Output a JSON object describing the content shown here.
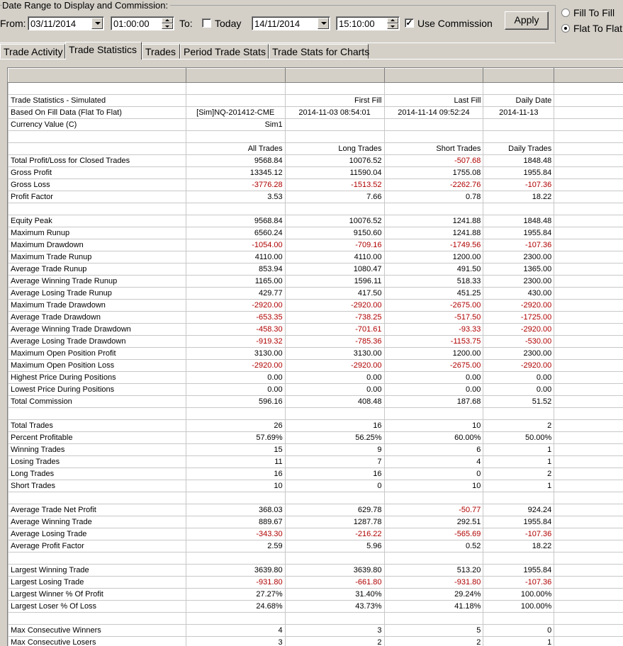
{
  "filter": {
    "group_title": "Date Range to Display and Commission:",
    "from_label": "From:",
    "from_date": "03/11/2014",
    "from_time": "01:00:00",
    "to_label": "To:",
    "today_label": "Today",
    "today_checked": false,
    "to_date": "14/11/2014",
    "to_time": "15:10:00",
    "use_commission_label": "Use Commission",
    "use_commission_checked": true,
    "apply_label": "Apply",
    "fill_to_fill_label": "Fill To Fill",
    "flat_to_flat_label": "Flat To Flat",
    "selected_mode": "Flat To Flat"
  },
  "tabs": [
    {
      "label": "Trade Activity",
      "active": false
    },
    {
      "label": "Trade Statistics",
      "active": true
    },
    {
      "label": "Trades",
      "active": false
    },
    {
      "label": "Period Trade Stats",
      "active": false
    },
    {
      "label": "Trade Stats for Charts",
      "active": false
    }
  ],
  "colors": {
    "negative": "#b00000",
    "window_bg": "#d4d0c8"
  },
  "rows": [
    {
      "label": "",
      "cells": [
        "",
        "",
        "",
        ""
      ],
      "neg": []
    },
    {
      "label": "Trade Statistics - Simulated",
      "cells": [
        "",
        "First Fill",
        "Last Fill",
        "Daily Date"
      ],
      "neg": []
    },
    {
      "label": "Based On Fill Data (Flat To Flat)",
      "cells": [
        "[Sim]NQ-201412-CME",
        "2014-11-03  08:54:01",
        "2014-11-14  09:52:24",
        "2014-11-13"
      ],
      "neg": [],
      "center": [
        0,
        1,
        2,
        3
      ]
    },
    {
      "label": "Currency Value (C)",
      "cells": [
        "Sim1",
        "",
        "",
        ""
      ],
      "neg": []
    },
    {
      "label": "",
      "cells": [
        "",
        "",
        "",
        ""
      ],
      "neg": []
    },
    {
      "label": "",
      "cells": [
        "All Trades",
        "Long Trades",
        "Short Trades",
        "Daily Trades"
      ],
      "neg": []
    },
    {
      "label": "Total Profit/Loss for Closed Trades",
      "cells": [
        "9568.84",
        "10076.52",
        "-507.68",
        "1848.48"
      ],
      "neg": [
        2
      ]
    },
    {
      "label": "Gross Profit",
      "cells": [
        "13345.12",
        "11590.04",
        "1755.08",
        "1955.84"
      ],
      "neg": []
    },
    {
      "label": "Gross Loss",
      "cells": [
        "-3776.28",
        "-1513.52",
        "-2262.76",
        "-107.36"
      ],
      "neg": [
        0,
        1,
        2,
        3
      ]
    },
    {
      "label": "Profit Factor",
      "cells": [
        "3.53",
        "7.66",
        "0.78",
        "18.22"
      ],
      "neg": []
    },
    {
      "label": "",
      "cells": [
        "",
        "",
        "",
        ""
      ],
      "neg": []
    },
    {
      "label": "Equity Peak",
      "cells": [
        "9568.84",
        "10076.52",
        "1241.88",
        "1848.48"
      ],
      "neg": []
    },
    {
      "label": "Maximum Runup",
      "cells": [
        "6560.24",
        "9150.60",
        "1241.88",
        "1955.84"
      ],
      "neg": []
    },
    {
      "label": "Maximum Drawdown",
      "cells": [
        "-1054.00",
        "-709.16",
        "-1749.56",
        "-107.36"
      ],
      "neg": [
        0,
        1,
        2,
        3
      ]
    },
    {
      "label": "Maximum Trade Runup",
      "cells": [
        "4110.00",
        "4110.00",
        "1200.00",
        "2300.00"
      ],
      "neg": []
    },
    {
      "label": "Average Trade Runup",
      "cells": [
        "853.94",
        "1080.47",
        "491.50",
        "1365.00"
      ],
      "neg": []
    },
    {
      "label": "Average Winning Trade Runup",
      "cells": [
        "1165.00",
        "1596.11",
        "518.33",
        "2300.00"
      ],
      "neg": []
    },
    {
      "label": "Average Losing Trade Runup",
      "cells": [
        "429.77",
        "417.50",
        "451.25",
        "430.00"
      ],
      "neg": []
    },
    {
      "label": "Maximum Trade Drawdown",
      "cells": [
        "-2920.00",
        "-2920.00",
        "-2675.00",
        "-2920.00"
      ],
      "neg": [
        0,
        1,
        2,
        3
      ]
    },
    {
      "label": "Average Trade Drawdown",
      "cells": [
        "-653.35",
        "-738.25",
        "-517.50",
        "-1725.00"
      ],
      "neg": [
        0,
        1,
        2,
        3
      ]
    },
    {
      "label": "Average Winning Trade Drawdown",
      "cells": [
        "-458.30",
        "-701.61",
        "-93.33",
        "-2920.00"
      ],
      "neg": [
        0,
        1,
        2,
        3
      ]
    },
    {
      "label": "Average Losing Trade Drawdown",
      "cells": [
        "-919.32",
        "-785.36",
        "-1153.75",
        "-530.00"
      ],
      "neg": [
        0,
        1,
        2,
        3
      ]
    },
    {
      "label": "Maximum Open Position Profit",
      "cells": [
        "3130.00",
        "3130.00",
        "1200.00",
        "2300.00"
      ],
      "neg": []
    },
    {
      "label": "Maximum Open Position Loss",
      "cells": [
        "-2920.00",
        "-2920.00",
        "-2675.00",
        "-2920.00"
      ],
      "neg": [
        0,
        1,
        2,
        3
      ]
    },
    {
      "label": "Highest Price During Positions",
      "cells": [
        "0.00",
        "0.00",
        "0.00",
        "0.00"
      ],
      "neg": []
    },
    {
      "label": "Lowest Price During Positions",
      "cells": [
        "0.00",
        "0.00",
        "0.00",
        "0.00"
      ],
      "neg": []
    },
    {
      "label": "Total Commission",
      "cells": [
        "596.16",
        "408.48",
        "187.68",
        "51.52"
      ],
      "neg": []
    },
    {
      "label": "",
      "cells": [
        "",
        "",
        "",
        ""
      ],
      "neg": []
    },
    {
      "label": "Total Trades",
      "cells": [
        "26",
        "16",
        "10",
        "2"
      ],
      "neg": []
    },
    {
      "label": "Percent Profitable",
      "cells": [
        "57.69%",
        "56.25%",
        "60.00%",
        "50.00%"
      ],
      "neg": []
    },
    {
      "label": "Winning Trades",
      "cells": [
        "15",
        "9",
        "6",
        "1"
      ],
      "neg": []
    },
    {
      "label": "Losing Trades",
      "cells": [
        "11",
        "7",
        "4",
        "1"
      ],
      "neg": []
    },
    {
      "label": "Long Trades",
      "cells": [
        "16",
        "16",
        "0",
        "2"
      ],
      "neg": []
    },
    {
      "label": "Short Trades",
      "cells": [
        "10",
        "0",
        "10",
        "1"
      ],
      "neg": []
    },
    {
      "label": "",
      "cells": [
        "",
        "",
        "",
        ""
      ],
      "neg": []
    },
    {
      "label": "Average Trade Net Profit",
      "cells": [
        "368.03",
        "629.78",
        "-50.77",
        "924.24"
      ],
      "neg": [
        2
      ]
    },
    {
      "label": "Average Winning Trade",
      "cells": [
        "889.67",
        "1287.78",
        "292.51",
        "1955.84"
      ],
      "neg": []
    },
    {
      "label": "Average Losing Trade",
      "cells": [
        "-343.30",
        "-216.22",
        "-565.69",
        "-107.36"
      ],
      "neg": [
        0,
        1,
        2,
        3
      ]
    },
    {
      "label": "Average Profit Factor",
      "cells": [
        "2.59",
        "5.96",
        "0.52",
        "18.22"
      ],
      "neg": []
    },
    {
      "label": "",
      "cells": [
        "",
        "",
        "",
        ""
      ],
      "neg": []
    },
    {
      "label": "Largest Winning Trade",
      "cells": [
        "3639.80",
        "3639.80",
        "513.20",
        "1955.84"
      ],
      "neg": []
    },
    {
      "label": "Largest Losing Trade",
      "cells": [
        "-931.80",
        "-661.80",
        "-931.80",
        "-107.36"
      ],
      "neg": [
        0,
        1,
        2,
        3
      ]
    },
    {
      "label": "Largest Winner % Of Profit",
      "cells": [
        "27.27%",
        "31.40%",
        "29.24%",
        "100.00%"
      ],
      "neg": []
    },
    {
      "label": "Largest Loser % Of Loss",
      "cells": [
        "24.68%",
        "43.73%",
        "41.18%",
        "100.00%"
      ],
      "neg": []
    },
    {
      "label": "",
      "cells": [
        "",
        "",
        "",
        ""
      ],
      "neg": []
    },
    {
      "label": "Max Consecutive Winners",
      "cells": [
        "4",
        "3",
        "5",
        "0"
      ],
      "neg": []
    },
    {
      "label": "Max Consecutive Losers",
      "cells": [
        "3",
        "2",
        "2",
        "1"
      ],
      "neg": []
    },
    {
      "label": "",
      "cells": [
        "",
        "",
        "",
        ""
      ],
      "neg": []
    }
  ]
}
